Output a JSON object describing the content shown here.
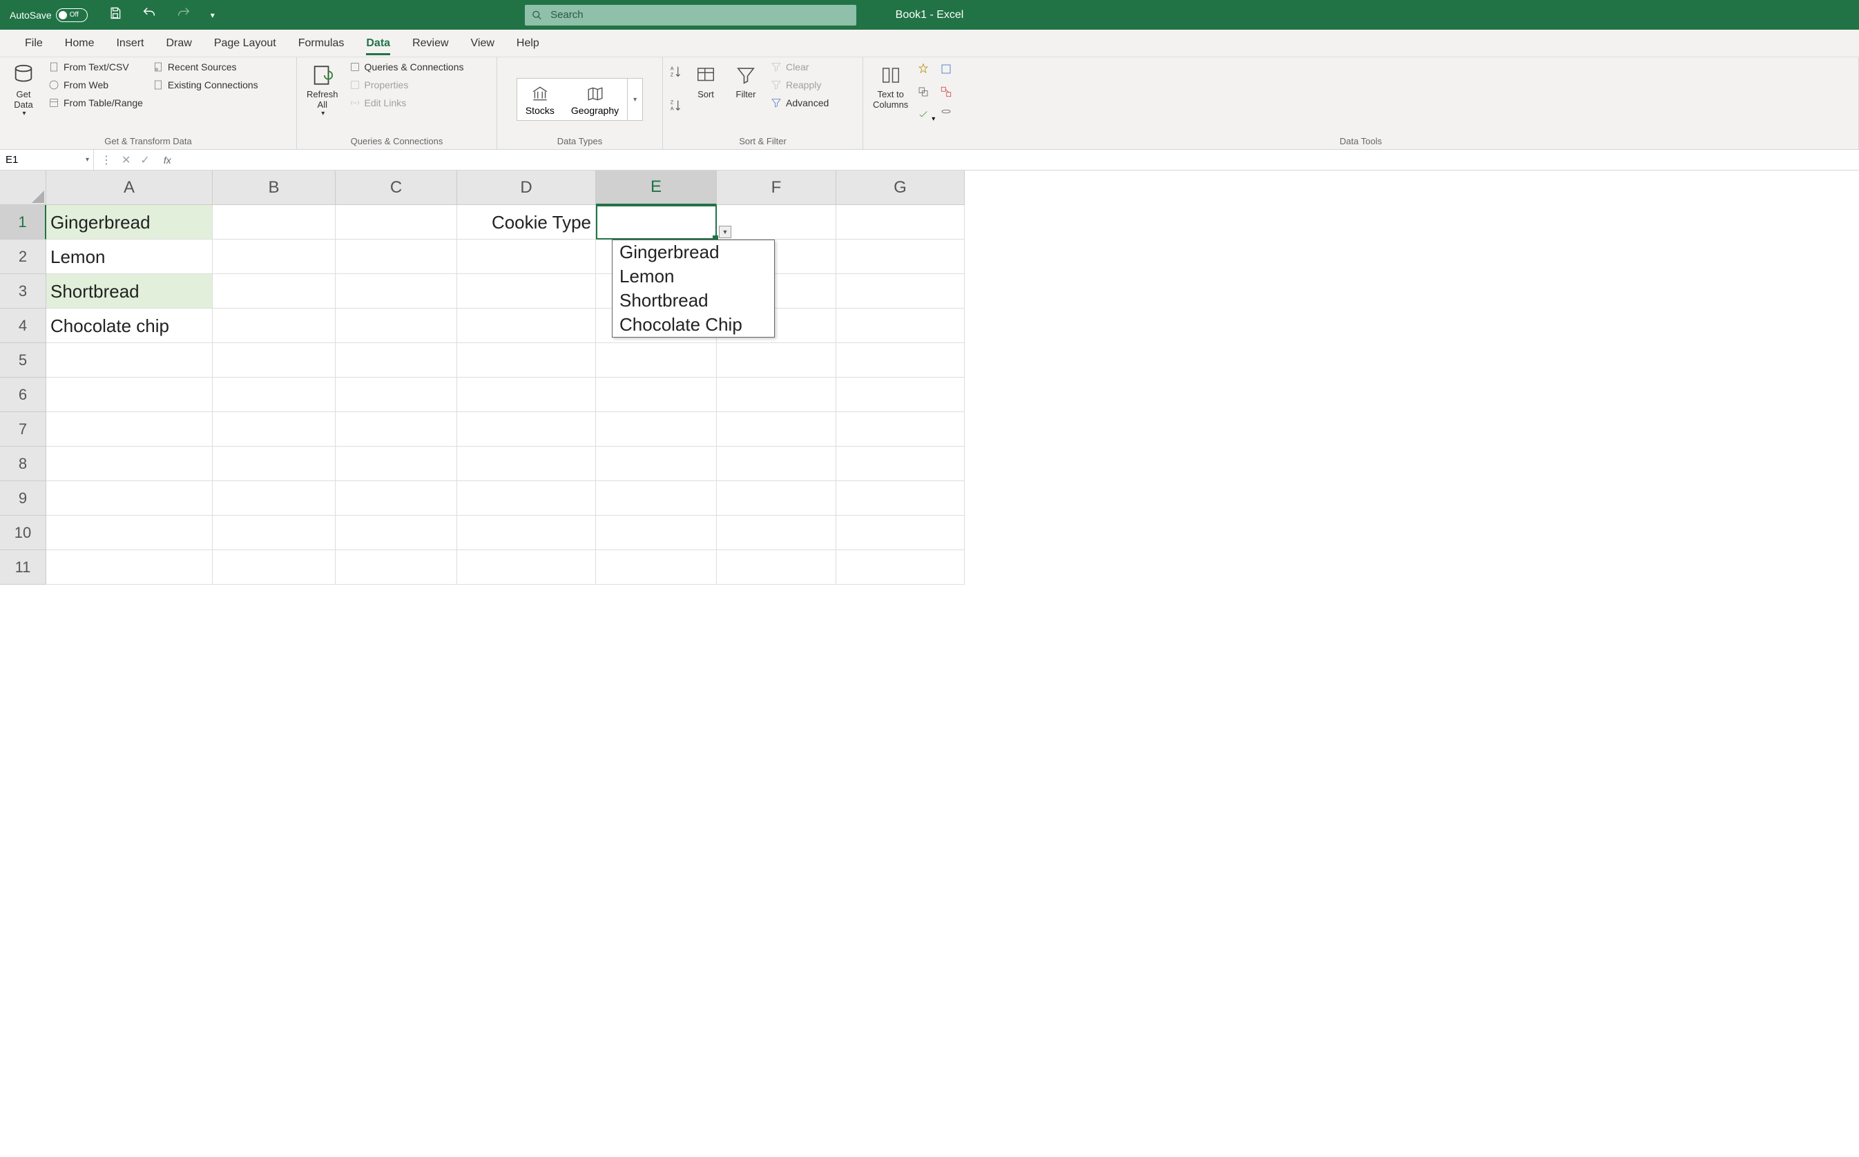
{
  "titlebar": {
    "autosave_label": "AutoSave",
    "autosave_state": "Off",
    "title": "Book1  -  Excel",
    "search_placeholder": "Search"
  },
  "tabs": [
    "File",
    "Home",
    "Insert",
    "Draw",
    "Page Layout",
    "Formulas",
    "Data",
    "Review",
    "View",
    "Help"
  ],
  "active_tab": "Data",
  "ribbon": {
    "groups": {
      "get_transform": {
        "label": "Get & Transform Data",
        "get_data": "Get\nData",
        "from_text_csv": "From Text/CSV",
        "from_web": "From Web",
        "from_table_range": "From Table/Range",
        "recent_sources": "Recent Sources",
        "existing_connections": "Existing Connections"
      },
      "queries": {
        "label": "Queries & Connections",
        "refresh_all": "Refresh\nAll",
        "queries_connections": "Queries & Connections",
        "properties": "Properties",
        "edit_links": "Edit Links"
      },
      "data_types": {
        "label": "Data Types",
        "stocks": "Stocks",
        "geography": "Geography"
      },
      "sort_filter": {
        "label": "Sort & Filter",
        "sort": "Sort",
        "filter": "Filter",
        "clear": "Clear",
        "reapply": "Reapply",
        "advanced": "Advanced"
      },
      "data_tools": {
        "label": "Data Tools",
        "text_to_columns": "Text to\nColumns"
      }
    }
  },
  "namebox": "E1",
  "formula": "",
  "columns": [
    "A",
    "B",
    "C",
    "D",
    "E",
    "F",
    "G"
  ],
  "selected_col": "E",
  "selected_row": 1,
  "row_count": 11,
  "cells": {
    "A1": "Gingerbread",
    "A2": "Lemon",
    "A3": "Shortbread",
    "A4": "Chocolate chip",
    "D1": "Cookie Type"
  },
  "highlighted": [
    "A1",
    "A3"
  ],
  "dropdown": {
    "items": [
      "Gingerbread",
      "Lemon",
      "Shortbread",
      "Chocolate Chip"
    ]
  }
}
